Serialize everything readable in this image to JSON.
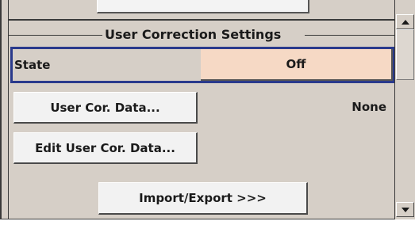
{
  "group": {
    "title": "User Correction Settings"
  },
  "state": {
    "label": "State",
    "value": "Off"
  },
  "buttons": {
    "user_cor_data": "User Cor. Data...",
    "edit_user_cor_data": "Edit User Cor. Data...",
    "import_export": "Import/Export >>>"
  },
  "user_cor_data_value": "None",
  "icons": {
    "scroll_up": "triangle-up-icon",
    "scroll_down": "triangle-down-icon"
  },
  "colors": {
    "panel_bg": "#d6cfc7",
    "state_value_bg": "#f6d9c5",
    "focus_border": "#2a3a8c",
    "button_bg": "#f2f2f2"
  }
}
